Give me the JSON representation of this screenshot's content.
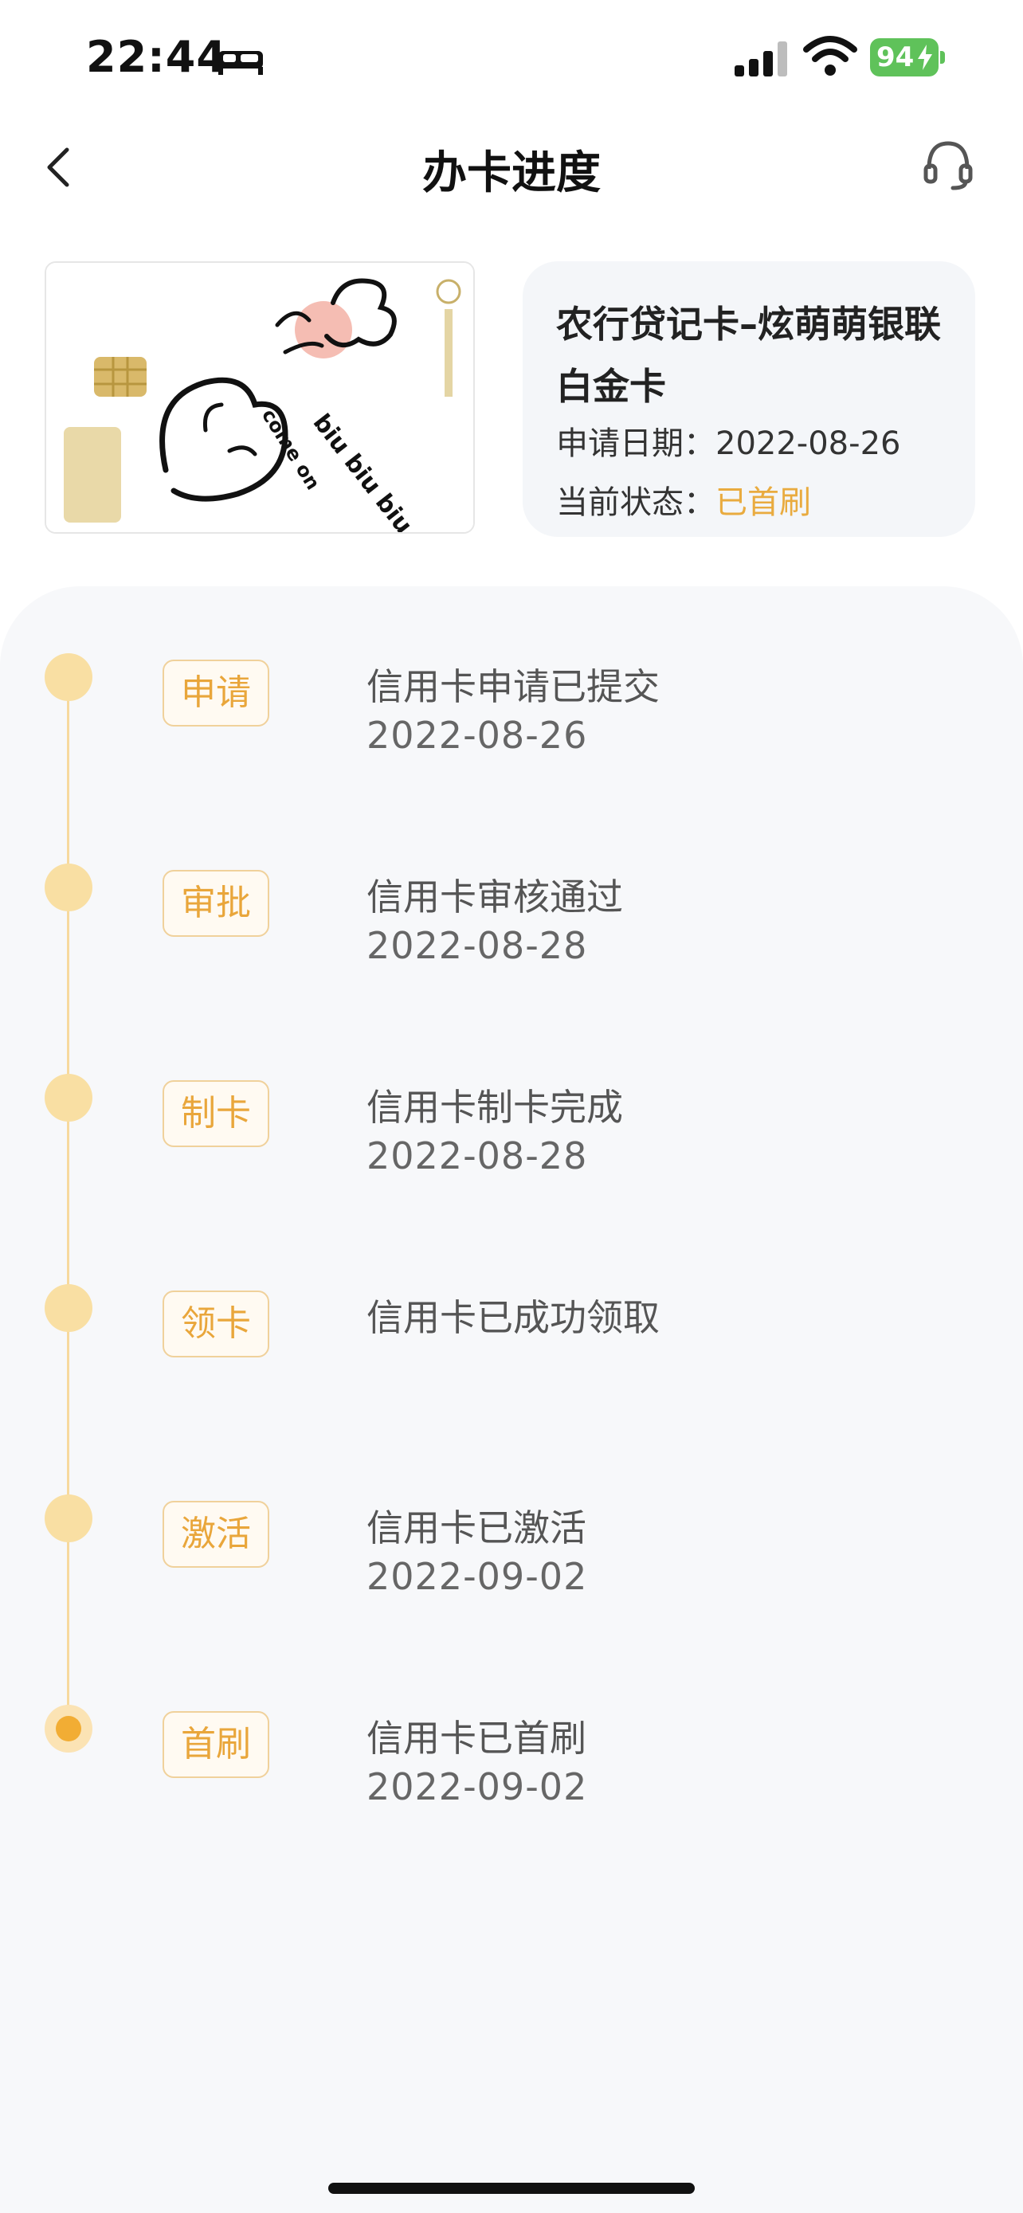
{
  "status_bar": {
    "time": "22:44",
    "battery": "94"
  },
  "nav": {
    "title": "办卡进度"
  },
  "card": {
    "name": "农行贷记卡–炫萌萌银联白金卡",
    "apply_date_label": "申请日期：",
    "apply_date": "2022-08-26",
    "status_label": "当前状态：",
    "status": "已首刷",
    "art_text_1": "biu biu biu",
    "art_text_2": "come on"
  },
  "timeline": [
    {
      "tag": "申请",
      "title": "信用卡申请已提交",
      "date": "2022-08-26"
    },
    {
      "tag": "审批",
      "title": "信用卡审核通过",
      "date": "2022-08-28"
    },
    {
      "tag": "制卡",
      "title": "信用卡制卡完成",
      "date": "2022-08-28"
    },
    {
      "tag": "领卡",
      "title": "信用卡已成功领取",
      "date": ""
    },
    {
      "tag": "激活",
      "title": "信用卡已激活",
      "date": "2022-09-02"
    },
    {
      "tag": "首刷",
      "title": "信用卡已首刷",
      "date": "2022-09-02"
    }
  ],
  "colors": {
    "accent": "#e9a63b",
    "active_dot": "#f2ad34",
    "dot": "#f9dfa3",
    "line": "#f7d99d"
  }
}
